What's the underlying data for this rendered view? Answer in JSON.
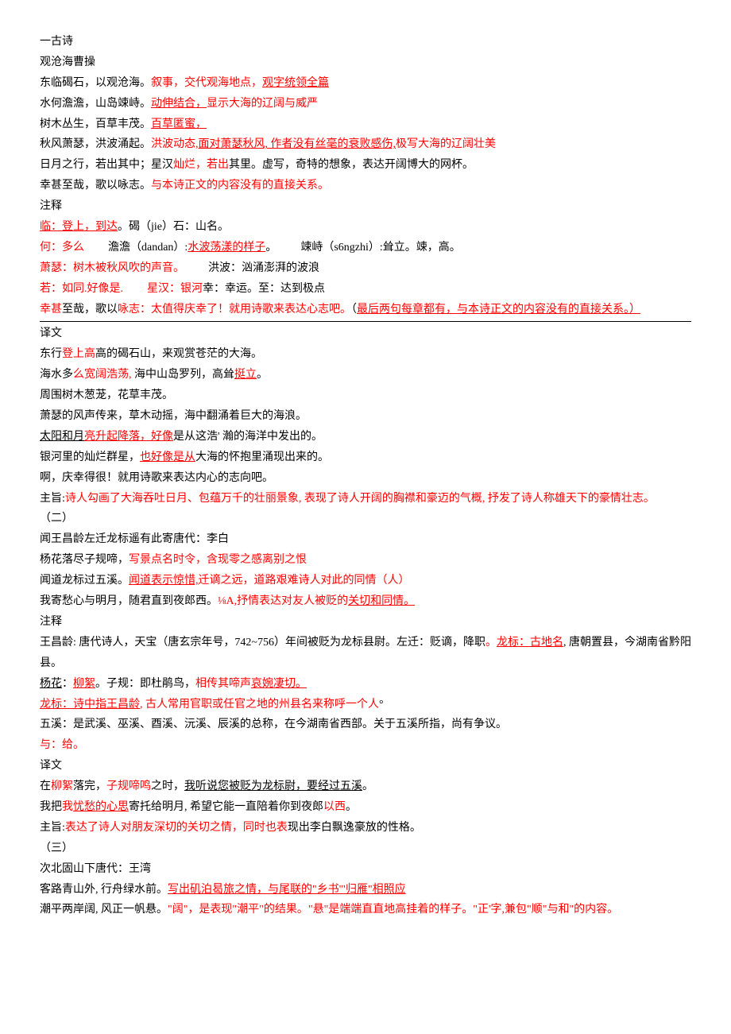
{
  "sec1": {
    "title": "一古诗",
    "title2": "观沧海曹操",
    "l1a": "东临碣石，以观沧海。",
    "l1b": "叙事，交代观海地点，",
    "l1c": "观字统领全篇",
    "l2a": "水何澹澹，山岛竦峙。",
    "l2b": "动伸结合，",
    "l2c": "显示大海的辽阔与威严",
    "l3a": "树木丛生，百草丰茂。",
    "l3b": "百草匿蜜，",
    "l4a": "秋风萧瑟，洪波涌起。",
    "l4b": "洪波动态,",
    "l4c": "面对萧瑟秋风, 作者没有丝毫的衰败感伤,",
    "l4d": "极写大海的辽阔壮美",
    "l5a": "日月之行，若出其中；星汉",
    "l5b": "灿烂，若出",
    "l5c": "其里。虚写，奇特的想象，表达开阔博大的网杯。",
    "l6a": "幸甚至哉，歌以咏志。",
    "l6b": "与本诗正文的内容没有的直接关系。"
  },
  "notes1": {
    "title": "注释",
    "n1a": "临：登上，到达",
    "n1b": "。碣（jie）石：山名。",
    "n2a": "何：多么",
    "n2b": "澹澹（dandan）:",
    "n2c": "水波荡漾的样子",
    "n2d": "。",
    "n2e": "竦峙（s6ngzhi）:耸立。竦，高。",
    "n3a": "萧瑟：树木被秋风吹的声音。",
    "n3b": "洪波：汹涌澎湃的波浪",
    "n4a": "若：如同.好像是.",
    "n4b": "星汉：银河",
    "n4c": "幸：幸运。至：达到极点",
    "n5a": "幸甚",
    "n5b": "至哉，歌以",
    "n5c": "咏志：",
    "n5d": "太值得庆幸了！就用诗歌来表达心志吧。",
    "n5e": "（",
    "n5f": "最后两句每章都有，与本诗正文的内容没有的直接关系。）"
  },
  "trans1": {
    "title": "译文",
    "t1a": "东行",
    "t1b": "登上高",
    "t1c": "高的碣石山，来观赏苍茫的大海。",
    "t2a": "海水多",
    "t2b": "么宽阔浩荡,",
    "t2c": " 海中山岛罗列，高耸",
    "t2d": "挺立",
    "t2e": "。",
    "t3": "周围树木葱茏，花草丰茂。",
    "t4": "萧瑟的风声传来，草木动摇，海中翻涌着巨大的海浪。",
    "t5a": "太阳和月",
    "t5b": "亮升起降落，好像",
    "t5c": "是从这浩' 瀚的海洋中发出的。",
    "t6a": "银河里的灿烂群星，",
    "t6b": "也好像是从",
    "t6c": "大海的怀抱里涌现出来的。",
    "t7": "啊，庆幸得很！就用诗歌来表达内心的志向吧。",
    "theme_label": "主旨:",
    "theme": "诗人勾画了大海吞吐日月、包蕴万千的壮丽景象, 表现了诗人开阔的胸襟和豪迈的气概, 抒发了诗人称雄天下的豪情壮志。"
  },
  "sec2": {
    "num": "（二）",
    "title": "闻王昌龄左迁龙标遥有此寄唐代：李白",
    "l1a": "杨花落尽子规啼，",
    "l1b": "写景点名时令，含现零之感离别之恨",
    "l2a": "闻道龙标过五溪。",
    "l2b": "闻道表示惊惜,",
    "l2c": "迁谪之远，道路艰难诗人对此的同情（人）",
    "l3a": "我寄愁心与明月，随君直到夜郎西。",
    "l3b": "⅛A,抒情表达对友人被贬的",
    "l3c": "关切和同情。"
  },
  "notes2": {
    "title": "注释",
    "n1a": "王昌龄: 唐代诗人，天宝（唐玄宗年号，742~756）年间被贬为龙标县尉。左迁：贬谪，降职",
    "n1b": "。",
    "n1c": "龙标：古地名",
    "n1d": ", 唐朝置县，今湖南省黔阳县。",
    "n2a": "杨花",
    "n2b": "：",
    "n2c": "柳絮",
    "n2d": "。子规：即杜鹃鸟，",
    "n2e": "相传其啼声",
    "n2f": "哀婉凄切。",
    "n3a": "龙标：诗中指王昌龄",
    "n3b": ", 古人常用官职或任官之地的州县名来称呼一个人",
    "n3c": "°",
    "n4": "五溪：是武溪、巫溪、酉溪、沅溪、辰溪的总称，在今湖南省西部。关于五溪所指，尚有争议。",
    "n5": "与：给。"
  },
  "trans2": {
    "title": "译文",
    "t1a": "在",
    "t1b": "柳絮",
    "t1c": "落完，",
    "t1d": "子规啼鸣",
    "t1e": "之时，",
    "t1f": "我听说您被贬为龙标尉，要经过五溪",
    "t1g": "。",
    "t2a": "我把",
    "t2b": "我",
    "t2c": "忧愁的心思",
    "t2d": "寄托给明月, 希望它能一直陪着你到夜郎",
    "t2e": "以西",
    "t2f": "。",
    "theme_label": "主旨:",
    "theme1": "表达了诗人对朋友深切的关切之情，同时也表",
    "theme2": "现出李白飘逸豪放的性格。"
  },
  "sec3": {
    "num": "（三）",
    "title": "次北固山下唐代：王湾",
    "l1a": "客路青山外, 行舟绿水前。",
    "l1b": "写出矶泊曷旅之情，与尾联的\"乡书'\"归雁\"相照应",
    "l2a": "潮平两岸阔, 风正一帆悬。",
    "l2b": "\"阔\"，是表现\"潮平\"的结果。\"悬\"是端端直直地高挂着的样子。\"正'字,兼包\"顺\"与和\"的内容。"
  }
}
